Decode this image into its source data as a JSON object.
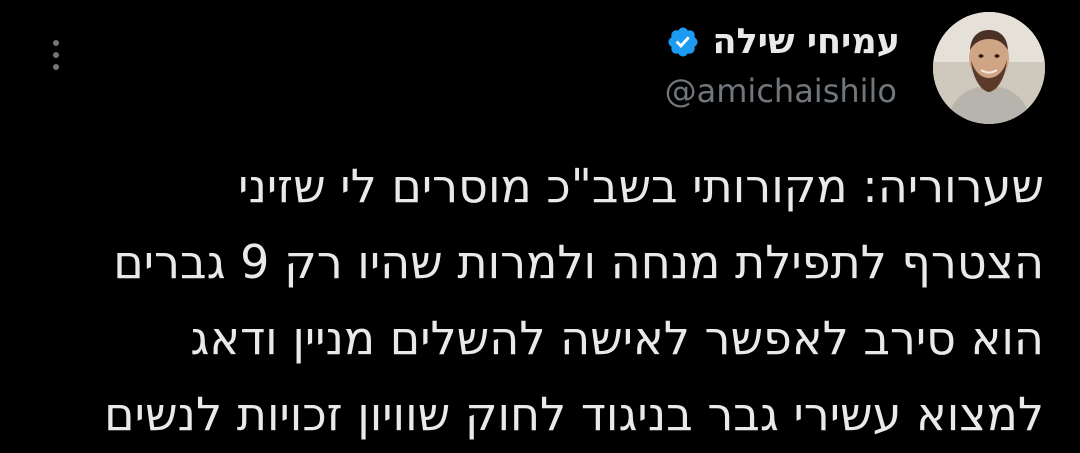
{
  "author": {
    "display_name": "עמיחי שילה",
    "handle": "@amichaishilo",
    "verified": true,
    "avatar_icon": "profile-photo"
  },
  "tweet": {
    "lines": [
      "שערוריה: מקורותי בשב\"כ מוסרים לי שזיני",
      "הצטרף לתפילת מנחה ולמרות שהיו רק 9 גברים",
      "הוא סירב לאפשר לאישה להשלים מניין ודאג",
      "למצוא עשירי גבר בניגוד לחוק שוויון זכויות לנשים"
    ]
  },
  "colors": {
    "background": "#000000",
    "text_primary": "#e7e9ea",
    "text_secondary": "#71767b",
    "verified_badge": "#1d9bf0"
  },
  "icons": {
    "more": "more-vertical-icon",
    "verified": "verified-badge-icon"
  }
}
